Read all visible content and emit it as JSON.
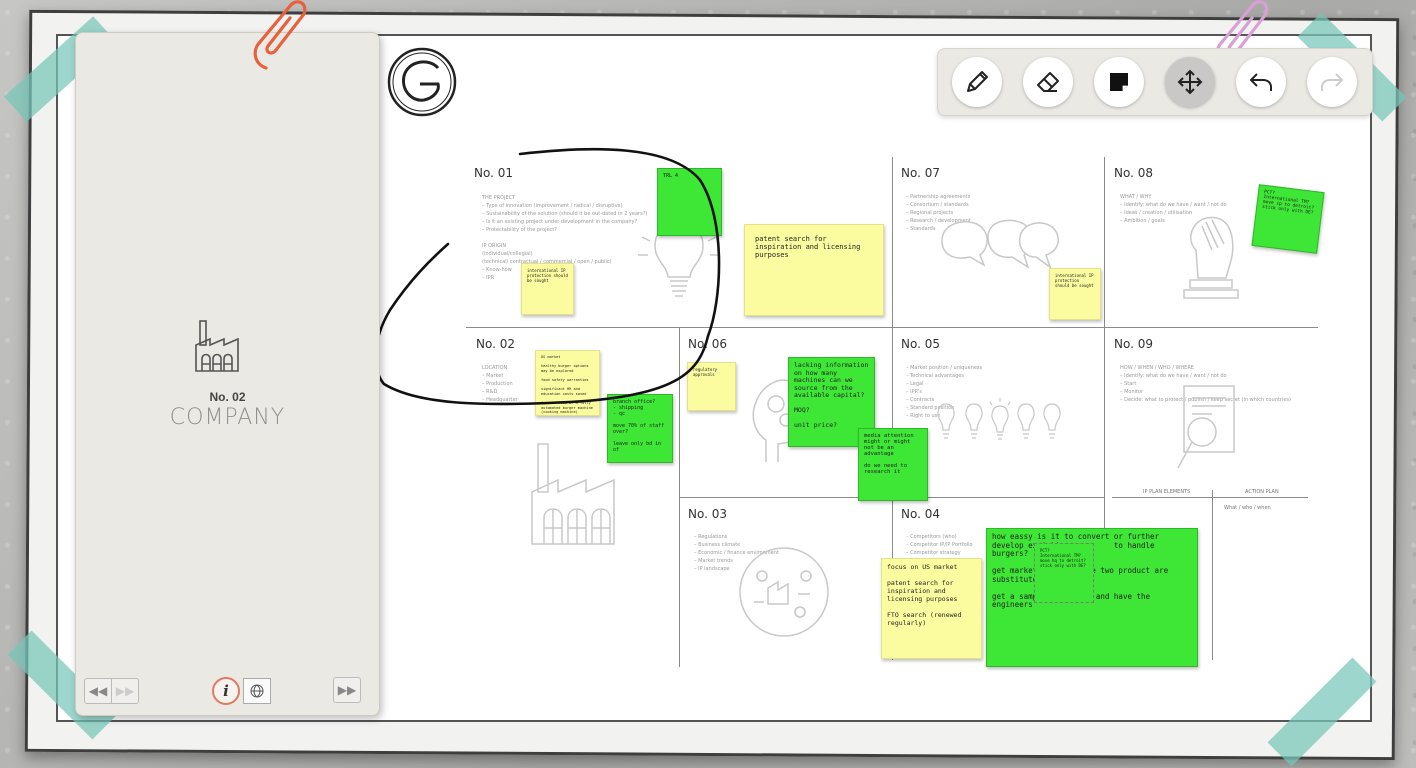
{
  "panel": {
    "number": "No. 02",
    "title": "COMPANY",
    "nav_prev": "◀◀",
    "nav_next_disabled": "▶▶",
    "nav_forward": "▶▶",
    "info": "i"
  },
  "toolbar": {
    "tools": [
      "pencil",
      "eraser",
      "sticky-note",
      "move",
      "undo",
      "redo"
    ],
    "active": "move"
  },
  "sections": [
    {
      "id": "01",
      "title": "No. 01",
      "bullets": "THE PROJECT\n– Type of innovation (improvement / radical / disruptive)\n– Sustainability of the solution (should it be out-dated in 2 years?)\n– Is it an existing project under development in the company?\n– Protectability of the project?\n\nIP ORIGIN\n(individual/collegial)\n(technical/ contractual / commercial / open / public)\n– Know-how\n– IPR"
    },
    {
      "id": "02",
      "title": "No. 02",
      "bullets": "LOCATION\n– Market\n– Production\n– R&D\n– Headquarter"
    },
    {
      "id": "06",
      "title": "No. 06",
      "bullets": ""
    },
    {
      "id": "07",
      "title": "No. 07",
      "bullets": "– Partnership agreements\n– Consortium / standards\n– Regional projects\n– Research / development\n– Standards"
    },
    {
      "id": "05",
      "title": "No. 05",
      "bullets": "– Market position / uniqueness\n– Technical advantages\n– Legal\n– IPR's\n– Contracts\n– Standard position\n– Right to use"
    },
    {
      "id": "08",
      "title": "No. 08",
      "bullets": "WHAT / WHY\n– Identify: what do we have / want / not do\n– Ideas / creation / utilisation\n– Ambition / goals"
    },
    {
      "id": "09",
      "title": "No. 09",
      "bullets": "HOW / WHEN / WHO / WHERE\n– Identify: what do we have / want / not do\n– Start\n– Monitor\n– Decide: what to protect / publish / keep secret (in which countries)"
    },
    {
      "id": "03",
      "title": "No. 03",
      "bullets": "– Regulations\n– Business climate\n– Economic / finance environment\n– Market trends\n– IP landscape"
    },
    {
      "id": "04",
      "title": "No. 04",
      "bullets": "– Competitors (who)\n– Competitor IP/IP Portfolio\n– Competitor strategy"
    }
  ],
  "ip_plan": {
    "col1": "IP PLAN ELEMENTS",
    "col2": "ACTION PLAN",
    "row": "What / who / when"
  },
  "notes": [
    {
      "id": "n1",
      "color": "g",
      "text": "TRL 4"
    },
    {
      "id": "n2",
      "color": "y",
      "text": "patent search for inspiration and licensing purposes"
    },
    {
      "id": "n3",
      "color": "y",
      "text": "international IP protection should be sought"
    },
    {
      "id": "n4",
      "color": "y",
      "text": "international IP protection should be sought"
    },
    {
      "id": "n5",
      "color": "g",
      "text": "PCT?\nInternational TM?\nmove ip to detroit?\nstick only with DE?"
    },
    {
      "id": "n6",
      "color": "y",
      "text": "US market\n\nhealthy burger options may be explored\n\nfood safety warranties\n\nsignificant HR and education costs saved\n\nfor the need of a fully automated burger machine (cooking machine)"
    },
    {
      "id": "n7",
      "color": "g",
      "text": "branch office?\n- shipping\n- qc\n\nmove 70% of staff over?\n\nleave only bd in of"
    },
    {
      "id": "n8",
      "color": "y",
      "text": "regulatory approvals"
    },
    {
      "id": "n9",
      "color": "g",
      "text": "lacking information on how many machines can we source from the available capital?\n\nMOQ?\n\nunit price?"
    },
    {
      "id": "n10",
      "color": "g",
      "text": "media attention might or might not be an advantage\n\ndo we need to research it"
    },
    {
      "id": "n11",
      "color": "y",
      "text": "focus on US market\n\npatent search for inspiration and licensing purposes\n\nFTO search (renewed regularly)"
    },
    {
      "id": "n12",
      "color": "g",
      "text": "how eassy is it to convert or further develop exeisting          to handle burgers?\n\nget market          the two product are substitute\n\nget a samp          ne and have the engineers"
    },
    {
      "id": "n13",
      "color": "g",
      "text": "PCT?\nInternational TM?\nmove hq to detroit?\nstick only with DE?"
    }
  ],
  "colors": {
    "yellow_note": "#fbfba0",
    "green_note": "#3ee636",
    "tape": "#76c6b8",
    "clip_red": "#e8603c",
    "clip_pink": "#d9a0d6"
  }
}
